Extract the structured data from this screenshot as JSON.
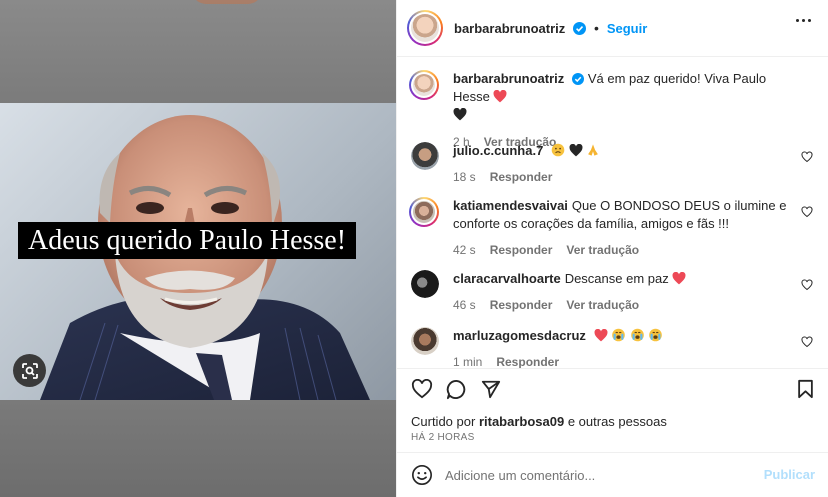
{
  "post": {
    "image_caption": "Adeus querido Paulo Hesse!",
    "lens_icon": "visual-search-icon"
  },
  "header": {
    "username": "barbarabrunoatriz",
    "separator": "•",
    "follow_label": "Seguir",
    "more_icon": "more-options-icon"
  },
  "caption_comment": {
    "username": "barbarabrunoatriz",
    "text": "Vá em paz querido! Viva Paulo Hesse",
    "time": "2 h",
    "translate": "Ver tradução"
  },
  "comments": [
    {
      "username": "julio.c.cunha.7",
      "text": "",
      "time": "18 s",
      "reply": "Responder",
      "translate": ""
    },
    {
      "username": "katiamendesvaivai",
      "text": "Que O BONDOSO DEUS o ilumine e conforte os corações da família, amigos e fãs !!!",
      "time": "42 s",
      "reply": "Responder",
      "translate": "Ver tradução"
    },
    {
      "username": "claracarvalhoarte",
      "text": "Descanse em paz",
      "time": "46 s",
      "reply": "Responder",
      "translate": "Ver tradução"
    },
    {
      "username": "marluzagomesdacruz",
      "text": "",
      "time": "1 min",
      "reply": "Responder",
      "translate": ""
    }
  ],
  "likes": {
    "prefix": "Curtido por",
    "user": "ritabarbosa09",
    "suffix": "e outras pessoas"
  },
  "timestamp": "HÁ 2 HORAS",
  "add_comment": {
    "placeholder": "Adicione um comentário...",
    "post_label": "Publicar"
  },
  "colors": {
    "accent": "#0095f6",
    "heart_red": "#ed4956",
    "post_disabled": "#b2dffc"
  }
}
